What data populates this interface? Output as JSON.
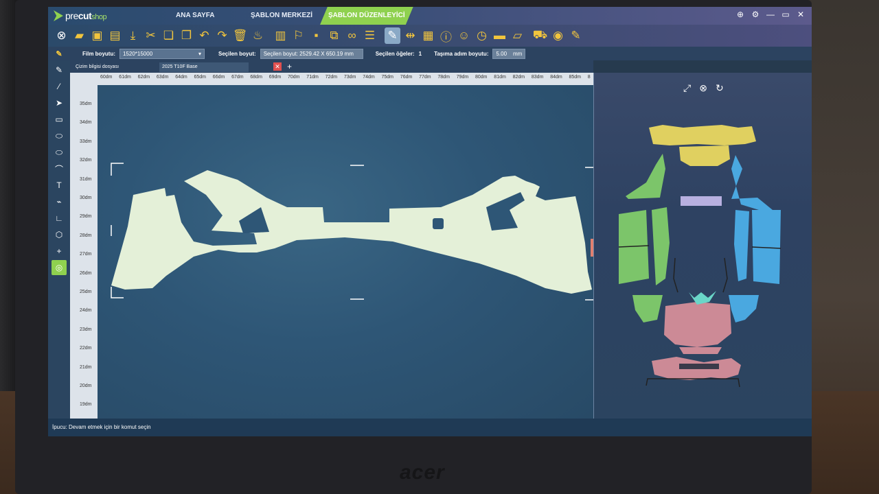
{
  "brand": {
    "name_pre": "pre",
    "name_cut": "cut",
    "name_shop": "shop",
    "hardware": "acer"
  },
  "nav": {
    "tabs": [
      "ANA SAYFA",
      "ŞABLON MERKEZİ",
      "ŞABLON DÜZENLEYİCİ"
    ],
    "active_index": 2
  },
  "window_controls": [
    "⊕",
    "⚙",
    "—",
    "▭",
    "✕"
  ],
  "toolbar": {
    "icons": [
      "close-icon",
      "folder-icon",
      "save-icon",
      "print-icon",
      "download-icon",
      "scissors-icon",
      "copy-icon",
      "paste-icon",
      "undo-icon",
      "redo-icon",
      "delete-icon",
      "broom-icon",
      "align-left-icon",
      "paint-remove-icon",
      "stamp-icon",
      "merge-icon",
      "link-icon",
      "stack-icon",
      "brush-icon",
      "distribute-icon",
      "export-icon",
      "info-icon",
      "palette-icon",
      "clock-icon",
      "ruler-icon",
      "eraser-icon",
      "car-select-icon",
      "eye-icon",
      "clipboard-icon"
    ],
    "glyphs": [
      "⊗",
      "▰",
      "▣",
      "▤",
      "⤓",
      "✂",
      "❏",
      "❐",
      "↶",
      "↷",
      "🗑",
      "♨",
      "▥",
      "⚐",
      "▪",
      "⧉",
      "∞",
      "☰",
      "✎",
      "⇹",
      "▦",
      "ⓘ",
      "☺",
      "◷",
      "▬",
      "▱",
      "⛟",
      "◉",
      "✎"
    ],
    "selected_index": 18
  },
  "options": {
    "film_label": "Film boyutu:",
    "film_value": "1520*15000",
    "selected_size_label": "Seçilen boyut:",
    "selected_size_value": "Seçilen boyut:  2529.42 X 650.19  mm",
    "selected_items_label": "Seçilen öğeler:",
    "selected_items_value": "1",
    "step_label": "Taşıma adım boyutu:",
    "step_value": "5.00",
    "step_unit": "mm"
  },
  "left_tools": [
    "✎",
    "⁄",
    "➤",
    "▭",
    "⬭",
    "⬭",
    "⌒",
    "T",
    "⌁",
    "∟",
    "⬡",
    "+",
    "◎"
  ],
  "left_tools_selected": 12,
  "doc_tabs": {
    "first": "Çizim bilgisi dosyası",
    "second": "2025 T10F Base",
    "close": "✕",
    "add": "+"
  },
  "rulers": {
    "top": [
      "60dm",
      "61dm",
      "62dm",
      "63dm",
      "64dm",
      "65dm",
      "66dm",
      "67dm",
      "68dm",
      "69dm",
      "70dm",
      "71dm",
      "72dm",
      "73dm",
      "74dm",
      "75dm",
      "76dm",
      "77dm",
      "78dm",
      "79dm",
      "80dm",
      "81dm",
      "82dm",
      "83dm",
      "84dm",
      "85dm",
      "8"
    ],
    "left": [
      "35dm",
      "34dm",
      "33dm",
      "32dm",
      "31dm",
      "30dm",
      "29dm",
      "28dm",
      "27dm",
      "26dm",
      "25dm",
      "24dm",
      "23dm",
      "22dm",
      "21dm",
      "20dm",
      "19dm"
    ]
  },
  "preview": {
    "icons": [
      "⤢",
      "⊗",
      "↻"
    ]
  },
  "status": {
    "text": "İpucu: Devam etmek için bir komut seçin"
  },
  "colors": {
    "accent": "#8fd14f",
    "icon": "#f2c53d",
    "shape": "#e4f0d8",
    "yellow": "#e0d060",
    "green": "#7cc56a",
    "blue": "#4aa8e0",
    "pink": "#cc8a96",
    "lavender": "#b8b0e0"
  }
}
